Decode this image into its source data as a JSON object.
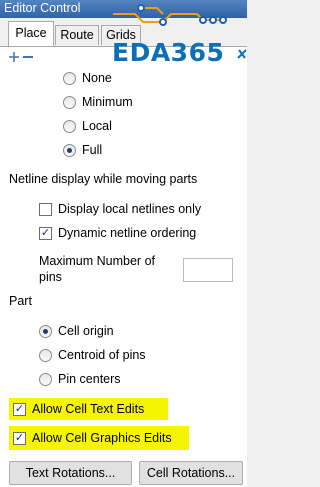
{
  "window": {
    "title": "Editor Control"
  },
  "tabs": [
    {
      "label": "Place",
      "active": true
    },
    {
      "label": "Route",
      "active": false
    },
    {
      "label": "Grids",
      "active": false
    }
  ],
  "watermark": {
    "text": "EDA365",
    "color": "#0d6fb5"
  },
  "toolbar": {
    "icons": [
      "expand-icon",
      "collapse-icon"
    ]
  },
  "display_options": {
    "items": [
      {
        "label": "None",
        "selected": false
      },
      {
        "label": "Minimum",
        "selected": false
      },
      {
        "label": "Local",
        "selected": false
      },
      {
        "label": "Full",
        "selected": true
      }
    ]
  },
  "netline": {
    "heading": "Netline display while moving parts",
    "display_local": {
      "label": "Display local netlines only",
      "checked": false
    },
    "dynamic_ordering": {
      "label": "Dynamic netline ordering",
      "checked": true
    },
    "max_pins_label_line1": "Maximum Number of",
    "max_pins_label_line2": "pins",
    "max_pins_value": ""
  },
  "part": {
    "heading": "Part",
    "items": [
      {
        "label": "Cell origin",
        "selected": true
      },
      {
        "label": "Centroid of pins",
        "selected": false
      },
      {
        "label": "Pin centers",
        "selected": false
      }
    ]
  },
  "allow": {
    "text_edits": {
      "label": "Allow Cell Text Edits",
      "checked": true
    },
    "graphics_edits": {
      "label": "Allow Cell Graphics Edits",
      "checked": true
    },
    "highlight_color": "#f6f400"
  },
  "buttons": {
    "text_rotations": "Text Rotations...",
    "cell_rotations": "Cell Rotations..."
  }
}
